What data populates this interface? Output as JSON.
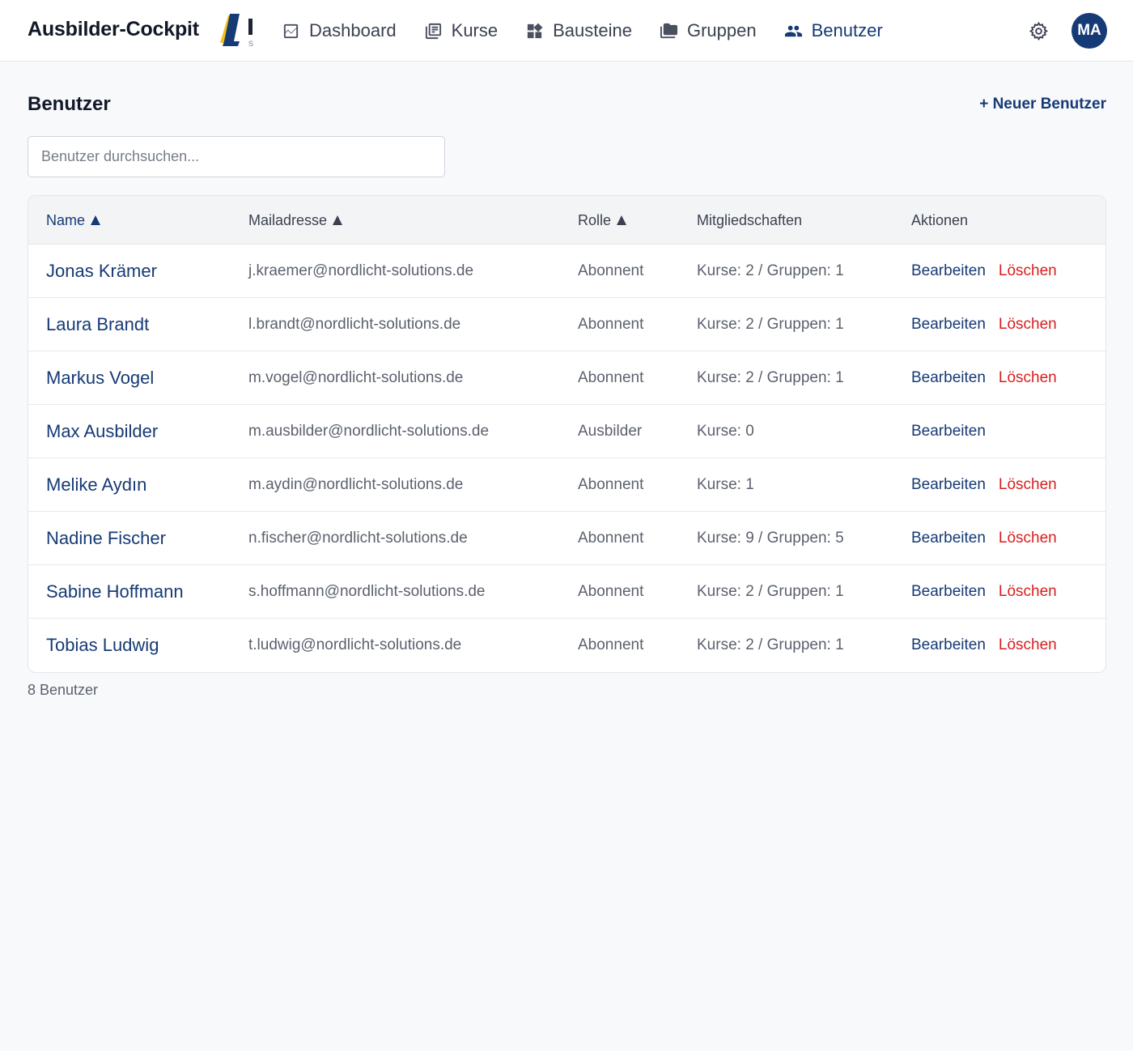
{
  "app": {
    "brand": "Ausbilder-Cockpit",
    "logo_letter": "L",
    "logo_sub": "S"
  },
  "nav": [
    {
      "label": "Dashboard",
      "icon": "chart-icon",
      "active": false
    },
    {
      "label": "Kurse",
      "icon": "library-icon",
      "active": false
    },
    {
      "label": "Bausteine",
      "icon": "widgets-icon",
      "active": false
    },
    {
      "label": "Gruppen",
      "icon": "folder-icon",
      "active": false
    },
    {
      "label": "Benutzer",
      "icon": "people-icon",
      "active": true
    }
  ],
  "header": {
    "settings_icon": "gear-icon",
    "avatar_initials": "MA"
  },
  "page": {
    "title": "Benutzer",
    "new_user_label": "+ Neuer Benutzer",
    "search_placeholder": "Benutzer durchsuchen...",
    "count_label": "8 Benutzer"
  },
  "table": {
    "columns": [
      {
        "label": "Name",
        "sorted": true
      },
      {
        "label": "Mailadresse",
        "sorted": true
      },
      {
        "label": "Rolle",
        "sorted": true
      },
      {
        "label": "Mitgliedschaften",
        "sorted": false
      },
      {
        "label": "Aktionen",
        "sorted": false
      }
    ],
    "edit_label": "Bearbeiten",
    "delete_label": "Löschen",
    "rows": [
      {
        "name": "Jonas Krämer",
        "mail": "j.kraemer@nordlicht-solutions.de",
        "role": "Abonnent",
        "memberships": "Kurse: 2 / Gruppen: 1",
        "deletable": true
      },
      {
        "name": "Laura Brandt",
        "mail": "l.brandt@nordlicht-solutions.de",
        "role": "Abonnent",
        "memberships": "Kurse: 2 / Gruppen: 1",
        "deletable": true
      },
      {
        "name": "Markus Vogel",
        "mail": "m.vogel@nordlicht-solutions.de",
        "role": "Abonnent",
        "memberships": "Kurse: 2 / Gruppen: 1",
        "deletable": true
      },
      {
        "name": "Max Ausbilder",
        "mail": "m.ausbilder@nordlicht-solutions.de",
        "role": "Ausbilder",
        "memberships": "Kurse: 0",
        "deletable": false
      },
      {
        "name": "Melike Aydın",
        "mail": "m.aydin@nordlicht-solutions.de",
        "role": "Abonnent",
        "memberships": "Kurse: 1",
        "deletable": true
      },
      {
        "name": "Nadine Fischer",
        "mail": "n.fischer@nordlicht-solutions.de",
        "role": "Abonnent",
        "memberships": "Kurse: 9 / Gruppen: 5",
        "deletable": true
      },
      {
        "name": "Sabine Hoffmann",
        "mail": "s.hoffmann@nordlicht-solutions.de",
        "role": "Abonnent",
        "memberships": "Kurse: 2 / Gruppen: 1",
        "deletable": true
      },
      {
        "name": "Tobias Ludwig",
        "mail": "t.ludwig@nordlicht-solutions.de",
        "role": "Abonnent",
        "memberships": "Kurse: 2 / Gruppen: 1",
        "deletable": true
      }
    ]
  },
  "colors": {
    "accent": "#163a75",
    "danger": "#d81e1e",
    "logo_yellow": "#f2c21b"
  }
}
